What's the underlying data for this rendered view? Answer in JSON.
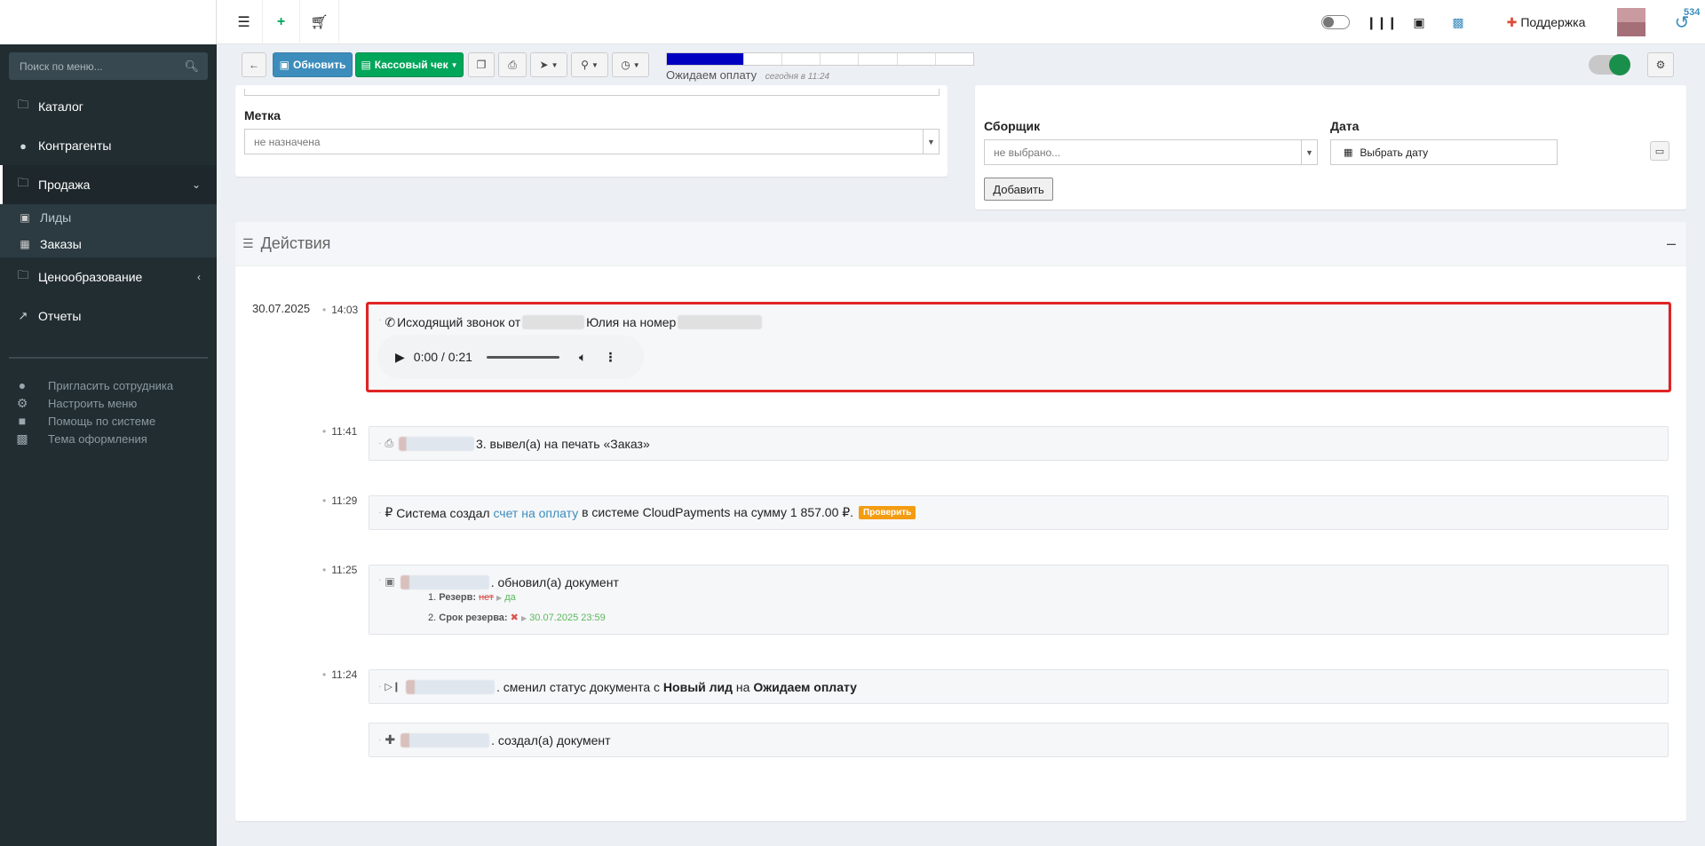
{
  "sidebar": {
    "search_placeholder": "Поиск по меню...",
    "items": [
      {
        "label": "Каталог",
        "icon": "folder-icon"
      },
      {
        "label": "Контрагенты",
        "icon": "users-icon"
      },
      {
        "label": "Продажа",
        "icon": "folder-icon"
      },
      {
        "label": "Ценообразование",
        "icon": "folder-icon"
      },
      {
        "label": "Отчеты",
        "icon": "chart-icon"
      }
    ],
    "subitems": [
      {
        "label": "Лиды",
        "icon": "lead-icon"
      },
      {
        "label": "Заказы",
        "icon": "basket-icon"
      }
    ],
    "extras": [
      {
        "label": "Пригласить сотрудника",
        "icon": "user-plus-icon"
      },
      {
        "label": "Настроить меню",
        "icon": "cogs-icon"
      },
      {
        "label": "Помощь по системе",
        "icon": "book-icon"
      },
      {
        "label": "Тема оформления",
        "icon": "image-icon"
      }
    ]
  },
  "topbar": {
    "support_label": "Поддержка",
    "notification_count": "534"
  },
  "toolbar": {
    "refresh_label": "Обновить",
    "receipt_label": "Кассовый чек",
    "status_label": "Ожидаем оплату",
    "status_time": "сегодня в 11:24",
    "progress_fraction": 0.25
  },
  "form": {
    "tag_label": "Метка",
    "tag_value": "не назначена",
    "picker_label": "Сборщик",
    "picker_value": "не выбрано...",
    "date_label": "Дата",
    "date_button": "Выбрать дату",
    "add_button": "Добавить"
  },
  "actions": {
    "title": "Действия",
    "date": "30.07.2025",
    "entries": [
      {
        "time": "14:03",
        "text_a": "Исходящий звонок от",
        "text_b": "Юлия на номер"
      },
      {
        "time": "11:41",
        "text_a": "3. вывел(а) на печать «Заказ»"
      },
      {
        "time": "11:29",
        "text_a": "Система создал",
        "link": "счет на оплату",
        "text_b": "в системе CloudPayments на сумму 1 857.00 ₽.",
        "badge": "Проверить"
      },
      {
        "time": "11:25",
        "text_a": ". обновил(а) документ"
      },
      {
        "time": "11:24",
        "text_a": ". сменил статус документа с",
        "from": "Новый лид",
        "mid": "на",
        "to": "Ожидаем оплату"
      },
      {
        "text_a": ". создал(а) документ"
      }
    ],
    "audio_time": "0:00 / 0:21",
    "details": [
      {
        "n": "1.",
        "key": "Резерв:",
        "old": "нет",
        "new": "да"
      },
      {
        "n": "2.",
        "key": "Срок резерва:",
        "new": "30.07.2025 23:59"
      }
    ]
  }
}
